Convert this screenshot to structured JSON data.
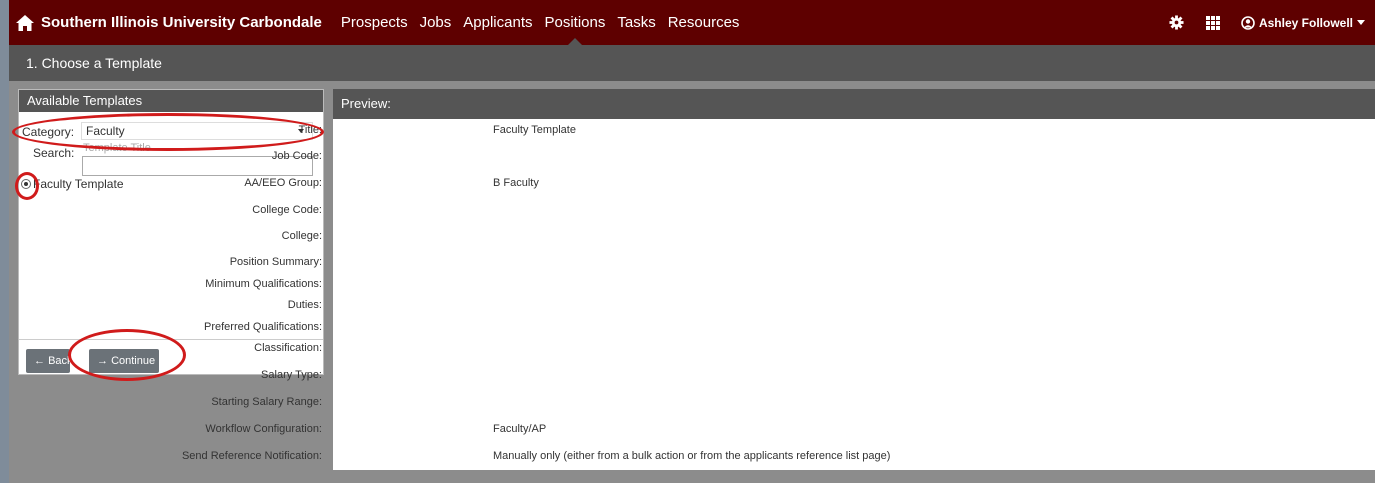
{
  "app": {
    "brand": "Southern Illinois University Carbondale",
    "nav": [
      "Prospects",
      "Jobs",
      "Applicants",
      "Positions",
      "Tasks",
      "Resources"
    ],
    "active_nav": "Positions",
    "user": "Ashley Followell",
    "colors": {
      "navbar": "#5e0000",
      "header": "#555555",
      "annotation": "#d01b1b"
    }
  },
  "wizard": {
    "step_title": "1. Choose a Template"
  },
  "templates": {
    "heading": "Available Templates",
    "category_label": "Category:",
    "category_value": "Faculty",
    "search_label": "Search:",
    "search_placeholder": "Template Title",
    "options": [
      {
        "label": "Faculty Template",
        "selected": true
      }
    ],
    "back_label": "Back",
    "continue_label": "Continue"
  },
  "preview": {
    "heading": "Preview:",
    "fields": [
      {
        "label": "Title:",
        "value": "Faculty Template"
      },
      {
        "label": "Job Code:",
        "value": ""
      },
      {
        "label": "AA/EEO Group:",
        "value": "B Faculty"
      },
      {
        "label": "College Code:",
        "value": ""
      },
      {
        "label": "College:",
        "value": ""
      },
      {
        "label": "Position Summary:",
        "value": ""
      },
      {
        "label": "Minimum Qualifications:",
        "value": ""
      },
      {
        "label": "Duties:",
        "value": ""
      },
      {
        "label": "Preferred Qualifications:",
        "value": ""
      },
      {
        "label": "Classification:",
        "value": ""
      },
      {
        "label": "Salary Type:",
        "value": ""
      },
      {
        "label": "Starting Salary Range:",
        "value": ""
      },
      {
        "label": "Workflow Configuration:",
        "value": "Faculty/AP"
      },
      {
        "label": "Send Reference Notification:",
        "value": "Manually only (either from a bulk action or from the applicants reference list page)"
      }
    ]
  }
}
